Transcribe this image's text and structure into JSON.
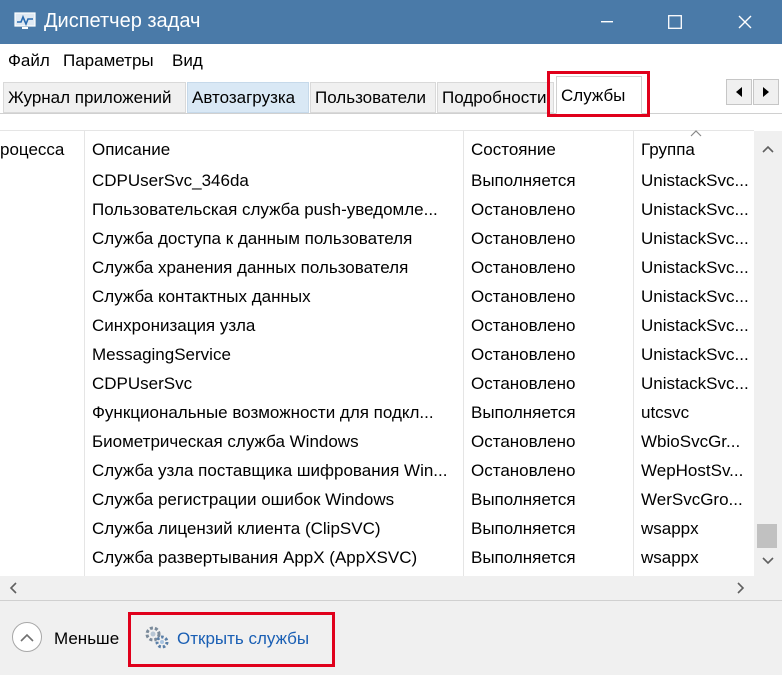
{
  "window": {
    "title": "Диспетчер задач",
    "colors": {
      "titlebar": "#4a7aa8",
      "highlight": "#e0001b",
      "link": "#1a5fb4"
    }
  },
  "menu": [
    "Файл",
    "Параметры",
    "Вид"
  ],
  "tabs": [
    {
      "label": "Журнал приложений"
    },
    {
      "label": "Автозагрузка"
    },
    {
      "label": "Пользователи"
    },
    {
      "label": "Подробности"
    },
    {
      "label": "Службы"
    }
  ],
  "active_tab": "Службы",
  "table": {
    "headers": {
      "process": "роцесса",
      "description": "Описание",
      "state": "Состояние",
      "group": "Группа"
    },
    "rows": [
      {
        "description": "CDPUserSvc_346da",
        "state": "Выполняется",
        "group": "UnistackSvc..."
      },
      {
        "description": "Пользовательская служба push-уведомле...",
        "state": "Остановлено",
        "group": "UnistackSvc..."
      },
      {
        "description": "Служба доступа к данным пользователя",
        "state": "Остановлено",
        "group": "UnistackSvc..."
      },
      {
        "description": "Служба хранения данных пользователя",
        "state": "Остановлено",
        "group": "UnistackSvc..."
      },
      {
        "description": "Служба контактных данных",
        "state": "Остановлено",
        "group": "UnistackSvc..."
      },
      {
        "description": "Синхронизация узла",
        "state": "Остановлено",
        "group": "UnistackSvc..."
      },
      {
        "description": "MessagingService",
        "state": "Остановлено",
        "group": "UnistackSvc..."
      },
      {
        "description": "CDPUserSvc",
        "state": "Остановлено",
        "group": "UnistackSvc..."
      },
      {
        "description": "Функциональные возможности для подкл...",
        "state": "Выполняется",
        "group": "utcsvc"
      },
      {
        "description": "Биометрическая служба Windows",
        "state": "Остановлено",
        "group": "WbioSvcGr..."
      },
      {
        "description": "Служба узла поставщика шифрования Win...",
        "state": "Остановлено",
        "group": "WepHostSv..."
      },
      {
        "description": "Служба регистрации ошибок Windows",
        "state": "Выполняется",
        "group": "WerSvcGro..."
      },
      {
        "description": "Служба лицензий клиента (ClipSVC)",
        "state": "Выполняется",
        "group": "wsappx"
      },
      {
        "description": "Служба развертывания AppX (AppXSVC)",
        "state": "Выполняется",
        "group": "wsappx"
      }
    ]
  },
  "footer": {
    "less_label": "Меньше",
    "open_services_label": "Открыть службы"
  }
}
